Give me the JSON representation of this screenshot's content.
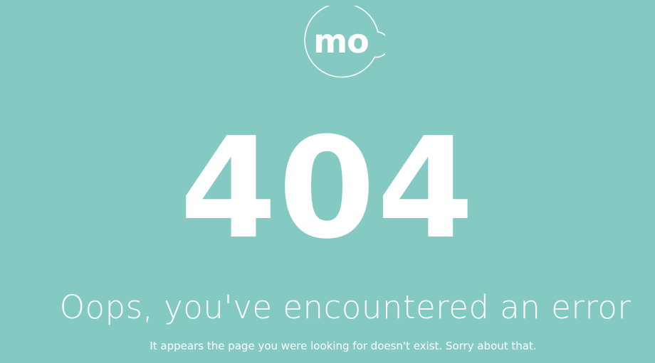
{
  "brand": {
    "logo_text": "mo",
    "logo_icon": "speech-bubble-outline"
  },
  "error": {
    "code": "404",
    "headline": "Oops, you've encountered an error",
    "message": "It appears the page you were looking for doesn't exist. Sorry about that."
  },
  "colors": {
    "background": "#84cac3",
    "foreground": "#ffffff"
  }
}
